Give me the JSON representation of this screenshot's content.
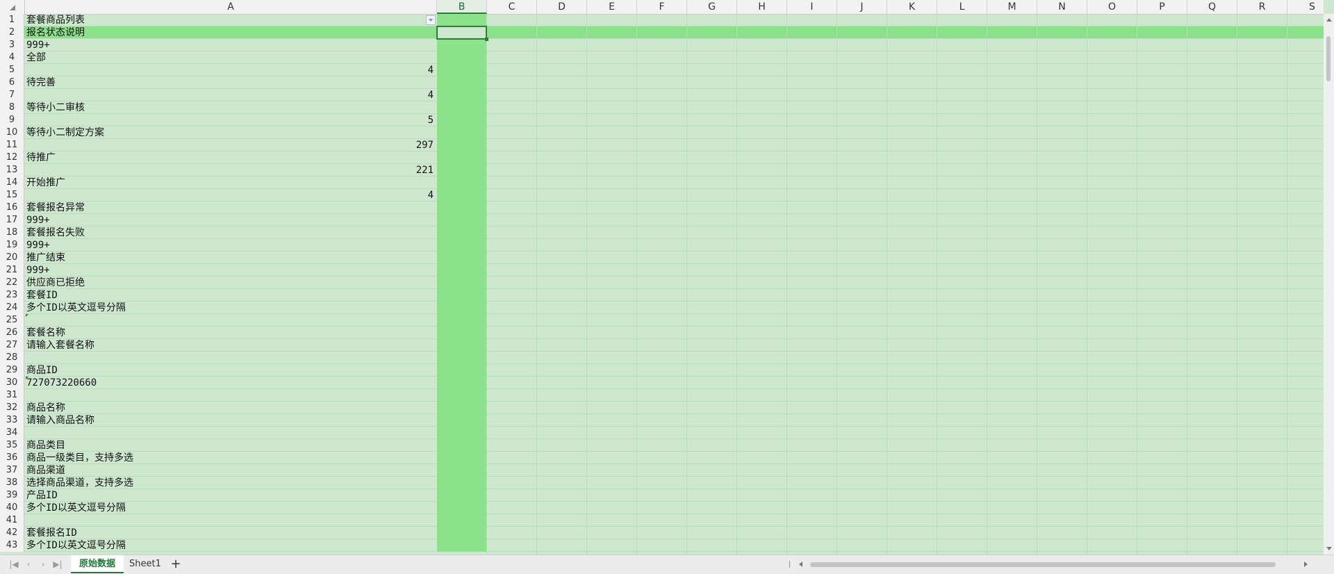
{
  "columns": [
    "A",
    "B",
    "C",
    "D",
    "E",
    "F",
    "G",
    "H",
    "I",
    "J",
    "K",
    "L",
    "M",
    "N",
    "O",
    "P",
    "Q",
    "R",
    "S"
  ],
  "selected_column": "B",
  "selected_row": 2,
  "rows": [
    {
      "n": "1",
      "a": "套餐商品列表",
      "num": false
    },
    {
      "n": "2",
      "a": "报名状态说明",
      "num": false
    },
    {
      "n": "3",
      "a": "999+",
      "num": false
    },
    {
      "n": "4",
      "a": "全部",
      "num": false
    },
    {
      "n": "5",
      "a": "4",
      "num": true
    },
    {
      "n": "6",
      "a": "待完善",
      "num": false
    },
    {
      "n": "7",
      "a": "4",
      "num": true
    },
    {
      "n": "8",
      "a": "等待小二审核",
      "num": false
    },
    {
      "n": "9",
      "a": "5",
      "num": true
    },
    {
      "n": "10",
      "a": "等待小二制定方案",
      "num": false
    },
    {
      "n": "11",
      "a": "297",
      "num": true
    },
    {
      "n": "12",
      "a": "待推广",
      "num": false
    },
    {
      "n": "13",
      "a": "221",
      "num": true
    },
    {
      "n": "14",
      "a": "开始推广",
      "num": false
    },
    {
      "n": "15",
      "a": "4",
      "num": true
    },
    {
      "n": "16",
      "a": "套餐报名异常",
      "num": false
    },
    {
      "n": "17",
      "a": "999+",
      "num": false
    },
    {
      "n": "18",
      "a": "套餐报名失败",
      "num": false
    },
    {
      "n": "19",
      "a": "999+",
      "num": false
    },
    {
      "n": "20",
      "a": "推广结束",
      "num": false
    },
    {
      "n": "21",
      "a": "999+",
      "num": false
    },
    {
      "n": "22",
      "a": "供应商已拒绝",
      "num": false
    },
    {
      "n": "23",
      "a": "套餐ID",
      "num": false
    },
    {
      "n": "24",
      "a": "多个ID以英文逗号分隔",
      "num": false
    },
    {
      "n": "25",
      "a": "",
      "num": false
    },
    {
      "n": "26",
      "a": "套餐名称",
      "num": false
    },
    {
      "n": "27",
      "a": "请输入套餐名称",
      "num": false
    },
    {
      "n": "28",
      "a": "",
      "num": false
    },
    {
      "n": "29",
      "a": "商品ID",
      "num": false
    },
    {
      "n": "30",
      "a": "727073220660",
      "num": false
    },
    {
      "n": "31",
      "a": "",
      "num": false
    },
    {
      "n": "32",
      "a": "商品名称",
      "num": false
    },
    {
      "n": "33",
      "a": "请输入商品名称",
      "num": false
    },
    {
      "n": "34",
      "a": "",
      "num": false
    },
    {
      "n": "35",
      "a": "商品类目",
      "num": false
    },
    {
      "n": "36",
      "a": "商品一级类目，支持多选",
      "num": false
    },
    {
      "n": "37",
      "a": "商品渠道",
      "num": false
    },
    {
      "n": "38",
      "a": "选择商品渠道，支持多选",
      "num": false
    },
    {
      "n": "39",
      "a": "产品ID",
      "num": false
    },
    {
      "n": "40",
      "a": "多个ID以英文逗号分隔",
      "num": false
    },
    {
      "n": "41",
      "a": "",
      "num": false
    },
    {
      "n": "42",
      "a": "套餐报名ID",
      "num": false
    },
    {
      "n": "43",
      "a": "多个ID以英文逗号分隔",
      "num": false
    }
  ],
  "sheet_tabs": [
    {
      "label": "原始数据",
      "active": true
    },
    {
      "label": "Sheet1",
      "active": false
    }
  ],
  "colors": {
    "cell_bg": "#cde8cf",
    "selected_row": "#8be28b",
    "accent": "#2e7d32"
  },
  "icons": [
    "first-sheet-icon",
    "prev-sheet-icon",
    "next-sheet-icon",
    "last-sheet-icon",
    "add-sheet-icon",
    "filter-dropdown-icon"
  ]
}
